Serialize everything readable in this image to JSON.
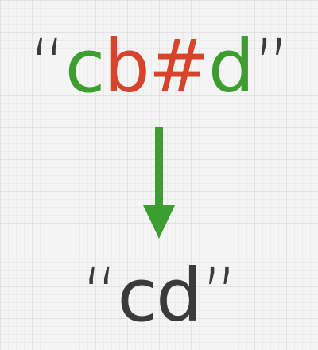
{
  "input": {
    "open_quote": "“",
    "chars": [
      {
        "text": "c",
        "color": "#3c9e2f"
      },
      {
        "text": "b",
        "color": "#d8432c"
      },
      {
        "text": "#",
        "color": "#d8432c"
      },
      {
        "text": "d",
        "color": "#3c9e2f"
      }
    ],
    "close_quote": "”"
  },
  "arrow": {
    "color": "#3c9e2f",
    "direction": "down"
  },
  "output": {
    "open_quote": "“",
    "text": "cd",
    "close_quote": "”",
    "color": "#3a3a3a"
  }
}
